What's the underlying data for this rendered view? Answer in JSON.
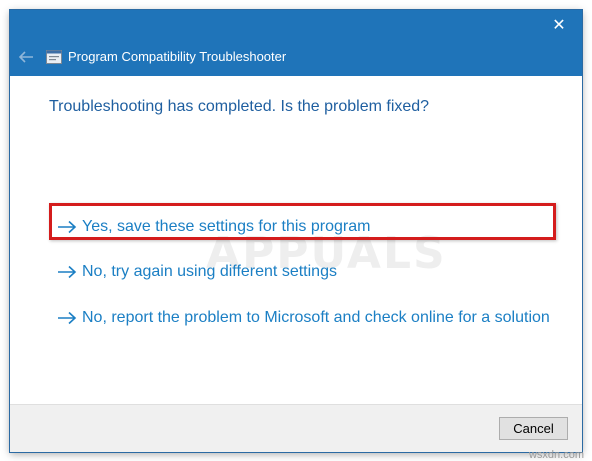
{
  "window": {
    "title": "Program Compatibility Troubleshooter",
    "close_glyph": "✕",
    "back_icon": "back-arrow-icon",
    "app_icon": "troubleshooter-icon"
  },
  "content": {
    "heading": "Troubleshooting has completed.  Is the problem fixed?",
    "options": [
      {
        "label": "Yes, save these settings for this program",
        "icon": "right-arrow-icon",
        "highlighted": true
      },
      {
        "label": "No, try again using different settings",
        "icon": "right-arrow-icon"
      },
      {
        "label": "No, report the problem to Microsoft and check online for a solution",
        "icon": "right-arrow-icon"
      }
    ],
    "watermark": "APPUALS"
  },
  "footer": {
    "cancel_label": "Cancel"
  },
  "site_credit": "wsxdn.com",
  "colors": {
    "titlebar": "#1f74b9",
    "heading": "#1f5fa0",
    "link": "#1b7fc4",
    "highlight": "#d41c1c"
  }
}
